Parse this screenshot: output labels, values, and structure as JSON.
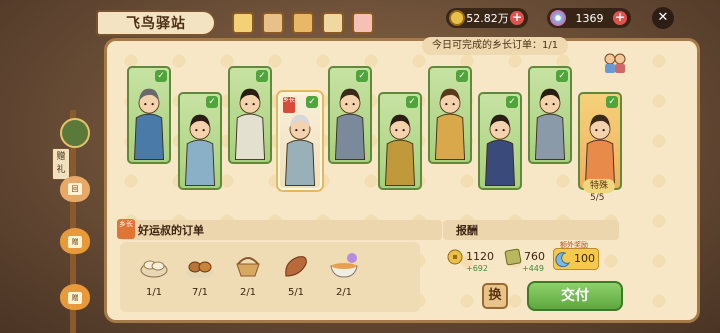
{
  "header": {
    "title": "飞鸟驿站"
  },
  "currency": {
    "coins": "52.82万",
    "gems": "1369"
  },
  "quota_text": "今日可完成的乡长订单：1/1",
  "side": {
    "gift_label": "赠礼",
    "bags": [
      "回",
      "赠",
      "赠"
    ]
  },
  "cards": [
    {
      "checked": true,
      "tag": ""
    },
    {
      "checked": true,
      "tag": ""
    },
    {
      "checked": true,
      "tag": ""
    },
    {
      "checked": true,
      "tag": "乡长"
    },
    {
      "checked": true,
      "tag": ""
    },
    {
      "checked": true,
      "tag": ""
    },
    {
      "checked": true,
      "tag": ""
    },
    {
      "checked": true,
      "tag": ""
    },
    {
      "checked": true,
      "tag": ""
    },
    {
      "checked": true,
      "tag": ""
    }
  ],
  "special": {
    "label": "特殊",
    "count": "5/5"
  },
  "order": {
    "badge": "乡长",
    "title": "好运叔的订单",
    "items": [
      {
        "icon": "dumpling-icon",
        "count": "1/1"
      },
      {
        "icon": "bread-icon",
        "count": "7/1"
      },
      {
        "icon": "basket-icon",
        "count": "2/1"
      },
      {
        "icon": "sweet-potato-icon",
        "count": "5/1"
      },
      {
        "icon": "noodle-bowl-icon",
        "count": "2/1"
      }
    ]
  },
  "reward": {
    "title": "报酬",
    "coins": "1120",
    "coins_bonus": "+692",
    "tickets": "760",
    "tickets_bonus": "+449",
    "bonus_label": "额外奖励",
    "bonus_value": "100"
  },
  "buttons": {
    "swap": "换",
    "submit": "交付"
  },
  "colors": {
    "panel": "#f7e7c6",
    "card_green": "#a9cf7e",
    "submit_green": "#5da840"
  }
}
